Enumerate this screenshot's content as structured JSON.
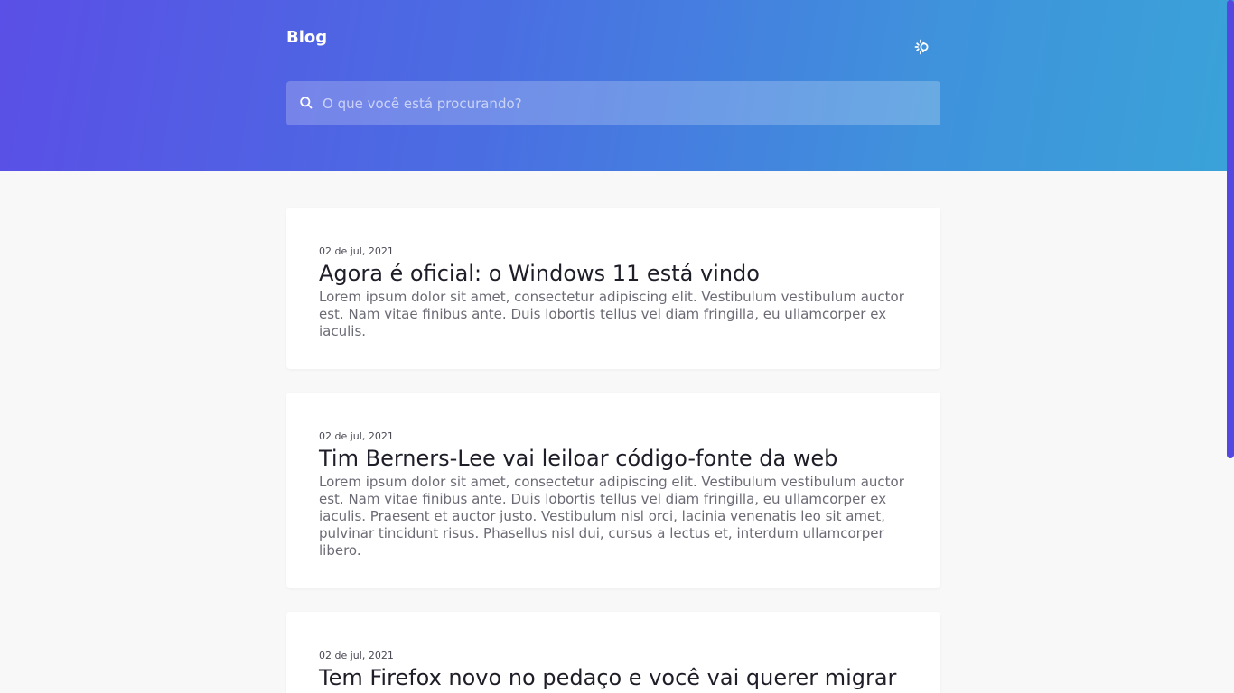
{
  "header": {
    "brand": "Blog",
    "theme_toggle_icon": "sun-icon"
  },
  "search": {
    "placeholder": "O que você está procurando?",
    "value": "",
    "icon": "search-icon"
  },
  "posts": [
    {
      "date": "02 de jul, 2021",
      "title": "Agora é oficial: o Windows 11 está vindo",
      "excerpt": "Lorem ipsum dolor sit amet, consectetur adipiscing elit. Vestibulum vestibulum auctor est. Nam vitae finibus ante. Duis lobortis tellus vel diam fringilla, eu ullamcorper ex iaculis."
    },
    {
      "date": "02 de jul, 2021",
      "title": "Tim Berners-Lee vai leiloar código-fonte da web",
      "excerpt": "Lorem ipsum dolor sit amet, consectetur adipiscing elit. Vestibulum vestibulum auctor est. Nam vitae finibus ante. Duis lobortis tellus vel diam fringilla, eu ullamcorper ex iaculis. Praesent et auctor justo. Vestibulum nisl orci, lacinia venenatis leo sit amet, pulvinar tincidunt risus. Phasellus nisl dui, cursus a lectus et, interdum ullamcorper libero."
    },
    {
      "date": "02 de jul, 2021",
      "title": "Tem Firefox novo no pedaço e você vai querer migrar",
      "excerpt": ""
    }
  ],
  "colors": {
    "gradient_start": "#5a4fe6",
    "gradient_end": "#3aa3d8",
    "background": "#f8f8f8",
    "scrollbar": "#5548e0"
  }
}
